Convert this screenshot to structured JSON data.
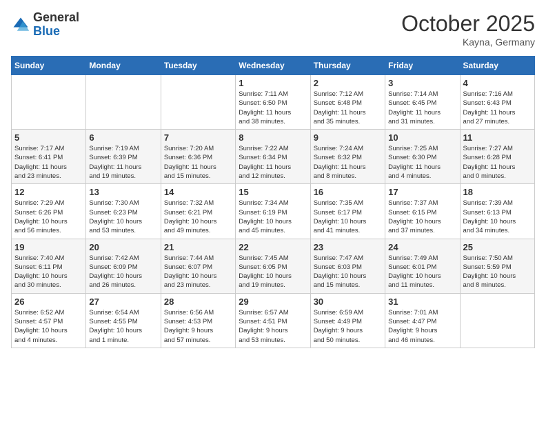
{
  "header": {
    "logo": {
      "general": "General",
      "blue": "Blue"
    },
    "title": "October 2025",
    "location": "Kayna, Germany"
  },
  "calendar": {
    "weekdays": [
      "Sunday",
      "Monday",
      "Tuesday",
      "Wednesday",
      "Thursday",
      "Friday",
      "Saturday"
    ],
    "weeks": [
      [
        {
          "day": "",
          "info": ""
        },
        {
          "day": "",
          "info": ""
        },
        {
          "day": "",
          "info": ""
        },
        {
          "day": "1",
          "info": "Sunrise: 7:11 AM\nSunset: 6:50 PM\nDaylight: 11 hours\nand 38 minutes."
        },
        {
          "day": "2",
          "info": "Sunrise: 7:12 AM\nSunset: 6:48 PM\nDaylight: 11 hours\nand 35 minutes."
        },
        {
          "day": "3",
          "info": "Sunrise: 7:14 AM\nSunset: 6:45 PM\nDaylight: 11 hours\nand 31 minutes."
        },
        {
          "day": "4",
          "info": "Sunrise: 7:16 AM\nSunset: 6:43 PM\nDaylight: 11 hours\nand 27 minutes."
        }
      ],
      [
        {
          "day": "5",
          "info": "Sunrise: 7:17 AM\nSunset: 6:41 PM\nDaylight: 11 hours\nand 23 minutes."
        },
        {
          "day": "6",
          "info": "Sunrise: 7:19 AM\nSunset: 6:39 PM\nDaylight: 11 hours\nand 19 minutes."
        },
        {
          "day": "7",
          "info": "Sunrise: 7:20 AM\nSunset: 6:36 PM\nDaylight: 11 hours\nand 15 minutes."
        },
        {
          "day": "8",
          "info": "Sunrise: 7:22 AM\nSunset: 6:34 PM\nDaylight: 11 hours\nand 12 minutes."
        },
        {
          "day": "9",
          "info": "Sunrise: 7:24 AM\nSunset: 6:32 PM\nDaylight: 11 hours\nand 8 minutes."
        },
        {
          "day": "10",
          "info": "Sunrise: 7:25 AM\nSunset: 6:30 PM\nDaylight: 11 hours\nand 4 minutes."
        },
        {
          "day": "11",
          "info": "Sunrise: 7:27 AM\nSunset: 6:28 PM\nDaylight: 11 hours\nand 0 minutes."
        }
      ],
      [
        {
          "day": "12",
          "info": "Sunrise: 7:29 AM\nSunset: 6:26 PM\nDaylight: 10 hours\nand 56 minutes."
        },
        {
          "day": "13",
          "info": "Sunrise: 7:30 AM\nSunset: 6:23 PM\nDaylight: 10 hours\nand 53 minutes."
        },
        {
          "day": "14",
          "info": "Sunrise: 7:32 AM\nSunset: 6:21 PM\nDaylight: 10 hours\nand 49 minutes."
        },
        {
          "day": "15",
          "info": "Sunrise: 7:34 AM\nSunset: 6:19 PM\nDaylight: 10 hours\nand 45 minutes."
        },
        {
          "day": "16",
          "info": "Sunrise: 7:35 AM\nSunset: 6:17 PM\nDaylight: 10 hours\nand 41 minutes."
        },
        {
          "day": "17",
          "info": "Sunrise: 7:37 AM\nSunset: 6:15 PM\nDaylight: 10 hours\nand 37 minutes."
        },
        {
          "day": "18",
          "info": "Sunrise: 7:39 AM\nSunset: 6:13 PM\nDaylight: 10 hours\nand 34 minutes."
        }
      ],
      [
        {
          "day": "19",
          "info": "Sunrise: 7:40 AM\nSunset: 6:11 PM\nDaylight: 10 hours\nand 30 minutes."
        },
        {
          "day": "20",
          "info": "Sunrise: 7:42 AM\nSunset: 6:09 PM\nDaylight: 10 hours\nand 26 minutes."
        },
        {
          "day": "21",
          "info": "Sunrise: 7:44 AM\nSunset: 6:07 PM\nDaylight: 10 hours\nand 23 minutes."
        },
        {
          "day": "22",
          "info": "Sunrise: 7:45 AM\nSunset: 6:05 PM\nDaylight: 10 hours\nand 19 minutes."
        },
        {
          "day": "23",
          "info": "Sunrise: 7:47 AM\nSunset: 6:03 PM\nDaylight: 10 hours\nand 15 minutes."
        },
        {
          "day": "24",
          "info": "Sunrise: 7:49 AM\nSunset: 6:01 PM\nDaylight: 10 hours\nand 11 minutes."
        },
        {
          "day": "25",
          "info": "Sunrise: 7:50 AM\nSunset: 5:59 PM\nDaylight: 10 hours\nand 8 minutes."
        }
      ],
      [
        {
          "day": "26",
          "info": "Sunrise: 6:52 AM\nSunset: 4:57 PM\nDaylight: 10 hours\nand 4 minutes."
        },
        {
          "day": "27",
          "info": "Sunrise: 6:54 AM\nSunset: 4:55 PM\nDaylight: 10 hours\nand 1 minute."
        },
        {
          "day": "28",
          "info": "Sunrise: 6:56 AM\nSunset: 4:53 PM\nDaylight: 9 hours\nand 57 minutes."
        },
        {
          "day": "29",
          "info": "Sunrise: 6:57 AM\nSunset: 4:51 PM\nDaylight: 9 hours\nand 53 minutes."
        },
        {
          "day": "30",
          "info": "Sunrise: 6:59 AM\nSunset: 4:49 PM\nDaylight: 9 hours\nand 50 minutes."
        },
        {
          "day": "31",
          "info": "Sunrise: 7:01 AM\nSunset: 4:47 PM\nDaylight: 9 hours\nand 46 minutes."
        },
        {
          "day": "",
          "info": ""
        }
      ]
    ]
  }
}
